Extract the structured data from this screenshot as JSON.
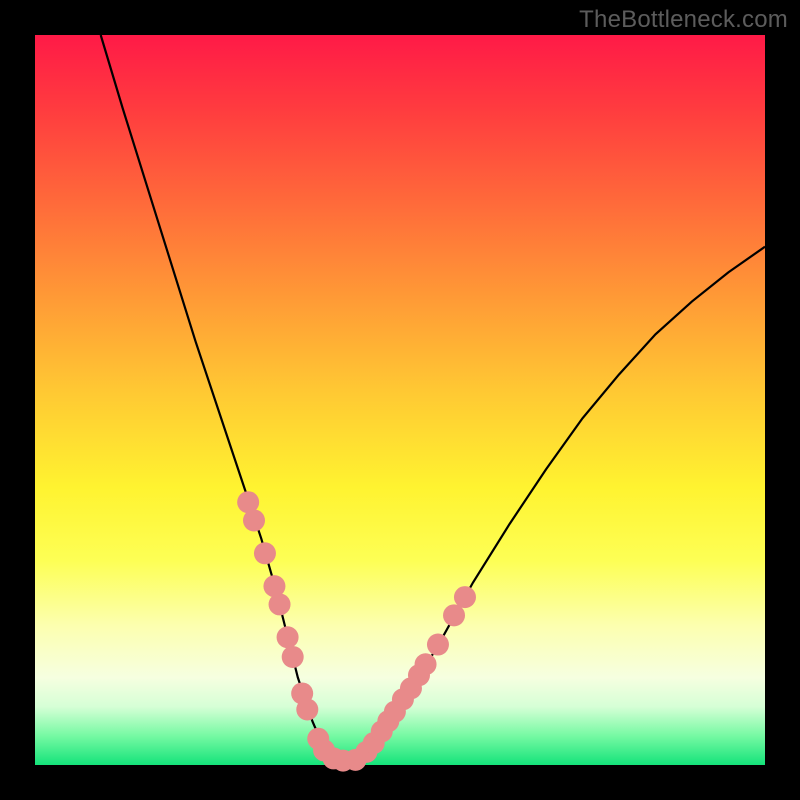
{
  "watermark": "TheBottleneck.com",
  "chart_data": {
    "type": "line",
    "title": "",
    "xlabel": "",
    "ylabel": "",
    "xlim": [
      0,
      100
    ],
    "ylim": [
      0,
      100
    ],
    "grid": false,
    "series": [
      {
        "name": "curve",
        "color": "#000000",
        "x": [
          9,
          12,
          17,
          22,
          27,
          29,
          31,
          33,
          34.5,
          36,
          38,
          39.5,
          41,
          43,
          46,
          50,
          55,
          60,
          65,
          70,
          75,
          80,
          85,
          90,
          95,
          100
        ],
        "values": [
          100,
          90,
          74,
          58,
          43,
          37,
          31,
          24,
          18,
          12,
          6,
          2.5,
          0.8,
          0.6,
          2.5,
          8,
          16,
          25,
          33,
          40.5,
          47.5,
          53.5,
          59,
          63.5,
          67.5,
          71
        ]
      }
    ],
    "markers": [
      {
        "name": "left-dots",
        "color": "#e88a8a",
        "radius": 11,
        "points": [
          {
            "x": 29.2,
            "y": 36.0
          },
          {
            "x": 30.0,
            "y": 33.5
          },
          {
            "x": 31.5,
            "y": 29.0
          },
          {
            "x": 32.8,
            "y": 24.5
          },
          {
            "x": 33.5,
            "y": 22.0
          },
          {
            "x": 34.6,
            "y": 17.5
          },
          {
            "x": 35.3,
            "y": 14.8
          },
          {
            "x": 36.6,
            "y": 9.8
          },
          {
            "x": 37.3,
            "y": 7.6
          },
          {
            "x": 38.8,
            "y": 3.6
          },
          {
            "x": 39.6,
            "y": 2.0
          },
          {
            "x": 40.9,
            "y": 0.9
          },
          {
            "x": 42.2,
            "y": 0.6
          },
          {
            "x": 43.9,
            "y": 0.7
          }
        ]
      },
      {
        "name": "right-dots",
        "color": "#e88a8a",
        "radius": 11,
        "points": [
          {
            "x": 45.4,
            "y": 1.8
          },
          {
            "x": 46.4,
            "y": 3.0
          },
          {
            "x": 47.5,
            "y": 4.6
          },
          {
            "x": 48.4,
            "y": 6.0
          },
          {
            "x": 49.3,
            "y": 7.3
          },
          {
            "x": 50.4,
            "y": 9.0
          },
          {
            "x": 51.5,
            "y": 10.5
          },
          {
            "x": 52.6,
            "y": 12.3
          },
          {
            "x": 53.5,
            "y": 13.8
          },
          {
            "x": 55.2,
            "y": 16.5
          },
          {
            "x": 57.4,
            "y": 20.5
          },
          {
            "x": 58.9,
            "y": 23.0
          }
        ]
      }
    ]
  }
}
